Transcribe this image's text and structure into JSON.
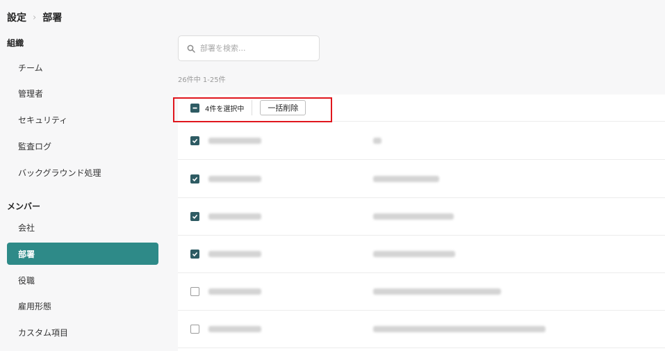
{
  "breadcrumb": {
    "parent": "設定",
    "separator": "›",
    "current": "部署"
  },
  "sidebar": {
    "sections": [
      {
        "title": "組織",
        "items": [
          "チーム",
          "管理者",
          "セキュリティ",
          "監査ログ",
          "バックグラウンド処理"
        ]
      },
      {
        "title": "メンバー",
        "items": [
          "会社",
          "部署",
          "役職",
          "雇用形態",
          "カスタム項目"
        ]
      }
    ],
    "active_item": "部署"
  },
  "search": {
    "placeholder": "部署を検索...",
    "value": "",
    "icon": "search-icon"
  },
  "result_count": "26件中 1-25件",
  "bulk": {
    "selected_label": "4件を選択中",
    "delete_label": "一括削除",
    "checkbox_state": "indeterminate"
  },
  "rows": [
    {
      "checked": true
    },
    {
      "checked": true
    },
    {
      "checked": true
    },
    {
      "checked": true
    },
    {
      "checked": false
    },
    {
      "checked": false
    }
  ],
  "colors": {
    "accent": "#2e8a88",
    "checkbox": "#2e5b63",
    "highlight": "#e0161d"
  }
}
